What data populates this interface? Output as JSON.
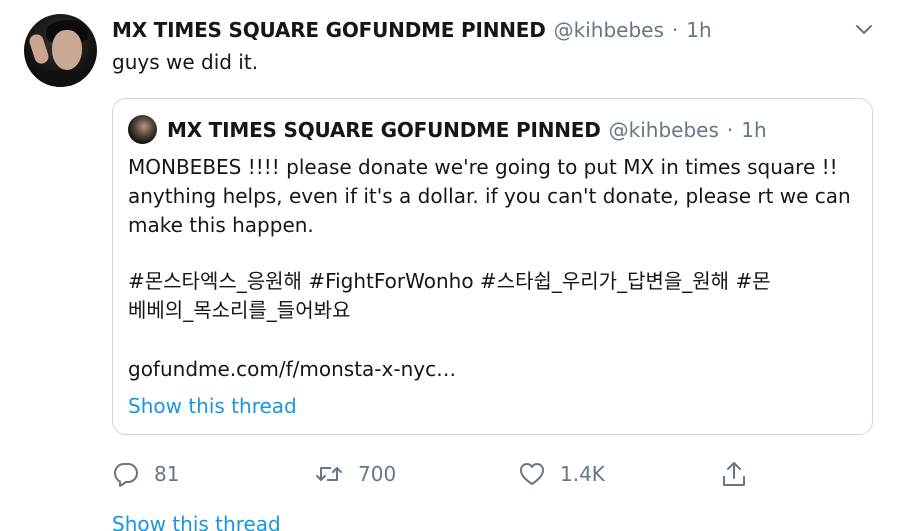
{
  "tweet": {
    "display_name": "MX TIMES SQUARE GOFUNDME PINNED",
    "handle": "@kihbebes",
    "separator": "·",
    "time": "1h",
    "text": "guys we did it."
  },
  "quoted_tweet": {
    "display_name": "MX TIMES SQUARE GOFUNDME PINNED",
    "handle": "@kihbebes",
    "separator": "·",
    "time": "1h",
    "line1": "MONBEBES !!!! please donate we're going to put MX in times square !!",
    "line2": "anything helps, even if it's a dollar. if you can't donate, please rt we can",
    "line3": "make this happen.",
    "hashtags_line1": "#몬스타엑스_응원해 #FightForWonho #스타쉽_우리가_답변을_원해 #몬",
    "hashtags_line2": "베베의_목소리를_들어봐요",
    "link": "gofundme.com/f/monsta-x-nyc…",
    "show_thread": "Show this thread"
  },
  "actions": {
    "replies": "81",
    "retweets": "700",
    "likes": "1.4K"
  },
  "show_thread": "Show this thread",
  "icons": {
    "menu": "chevron-down-icon",
    "reply": "reply-icon",
    "retweet": "retweet-icon",
    "like": "heart-icon",
    "share": "share-icon"
  },
  "colors": {
    "link": "#1b95e0",
    "muted": "#657786",
    "border": "#ccd6dd",
    "text": "#14171a"
  }
}
